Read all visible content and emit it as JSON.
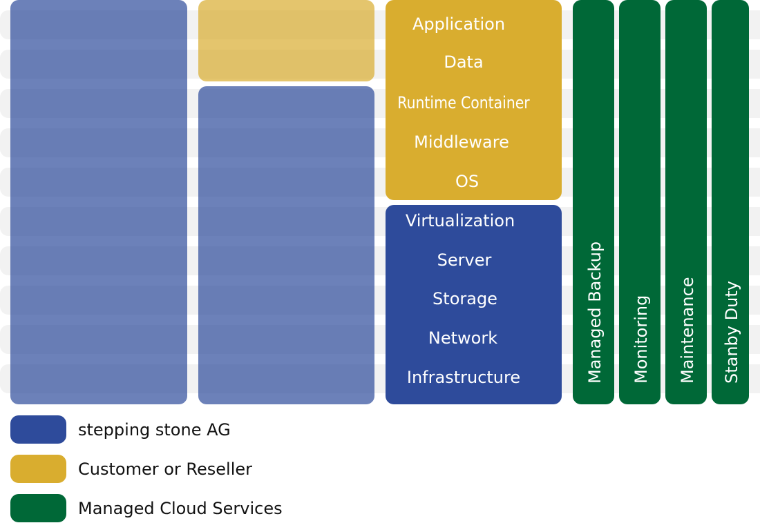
{
  "colors": {
    "stepping_stone": "#2e4b9b",
    "customer": "#d9ad2f",
    "managed": "#006837",
    "stripe": "#f2f2f2"
  },
  "customer_layers": [
    "Application",
    "Data",
    "Runtime Container",
    "Middleware",
    "OS"
  ],
  "provider_layers": [
    "Virtualization",
    "Server",
    "Storage",
    "Network",
    "Infrastructure"
  ],
  "services": [
    "Managed Backup",
    "Monitoring",
    "Maintenance",
    "Stanby Duty"
  ],
  "legend": [
    {
      "label": "stepping stone AG",
      "color": "#2e4b9b"
    },
    {
      "label": "Customer or Reseller",
      "color": "#d9ad2f"
    },
    {
      "label": "Managed Cloud Services",
      "color": "#006837"
    }
  ]
}
